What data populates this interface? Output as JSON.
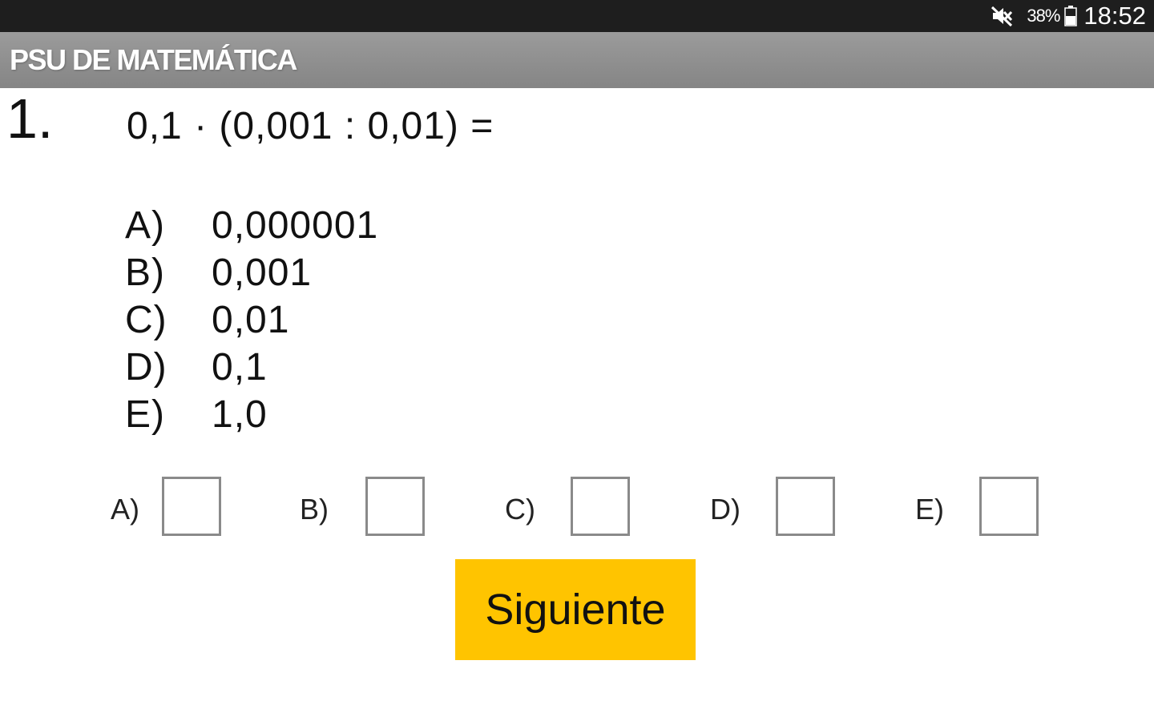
{
  "status_bar": {
    "icons": [
      "mute-icon",
      "battery-icon"
    ],
    "battery_percent": "38%",
    "time": "18:52",
    "background": "#1e1e1e"
  },
  "app_bar": {
    "title": "PSU DE MATEMÁTICA",
    "background": "#8e8e8e"
  },
  "question": {
    "number": "1.",
    "expression": "0,1 · (0,001 : 0,01) =",
    "options": [
      {
        "letter": "A)",
        "value": "0,000001"
      },
      {
        "letter": "B)",
        "value": "0,001"
      },
      {
        "letter": "C)",
        "value": "0,01"
      },
      {
        "letter": "D)",
        "value": "0,1"
      },
      {
        "letter": "E)",
        "value": "1,0"
      }
    ]
  },
  "answers": [
    {
      "label": "A)",
      "checked": false
    },
    {
      "label": "B)",
      "checked": false
    },
    {
      "label": "C)",
      "checked": false
    },
    {
      "label": "D)",
      "checked": false
    },
    {
      "label": "E)",
      "checked": false
    }
  ],
  "next_button": {
    "label": "Siguiente",
    "color": "#ffc400"
  }
}
